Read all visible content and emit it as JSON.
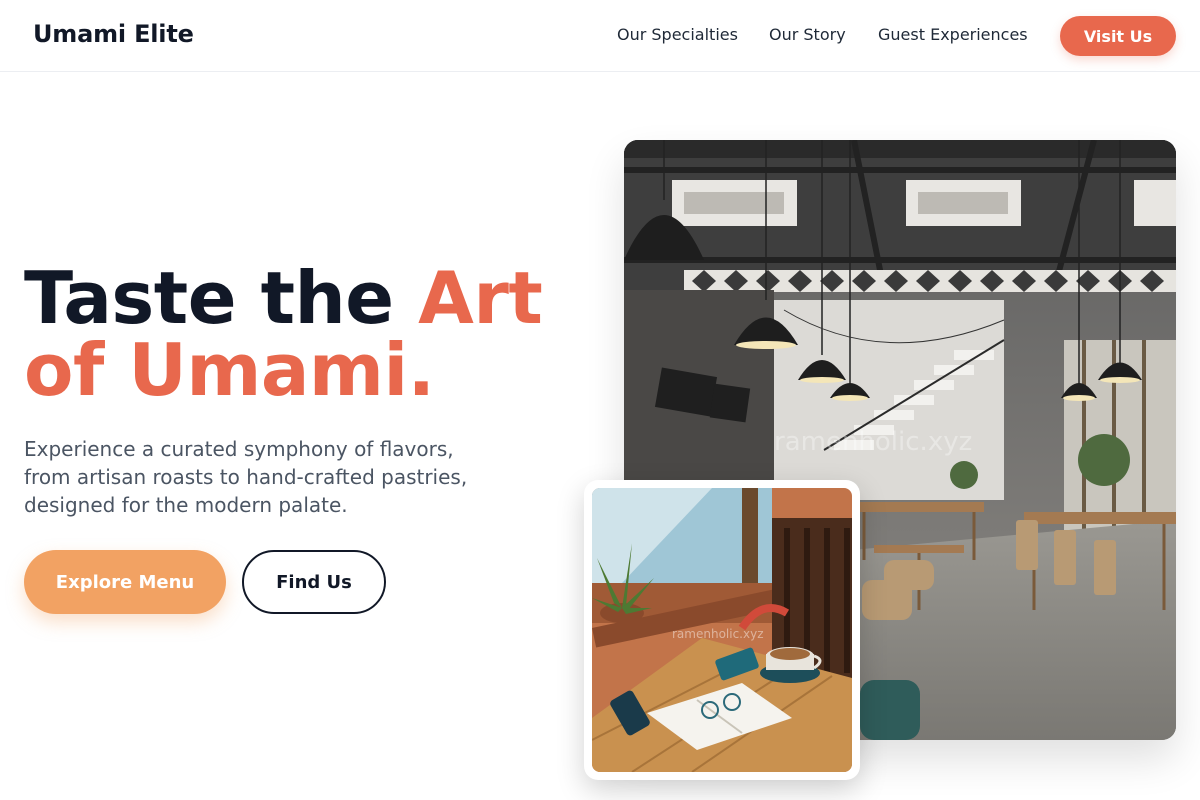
{
  "brand": {
    "name": "Umami Elite"
  },
  "nav": {
    "items": [
      "Our Specialties",
      "Our Story",
      "Guest Experiences"
    ],
    "cta_label": "Visit Us"
  },
  "hero": {
    "headline_part1": "Taste the ",
    "headline_accent1": "Art",
    "headline_accent2": "of Umami.",
    "subtitle": "Experience a curated symphony of flavors, from artisan roasts to hand-crafted pastries, designed for the modern palate.",
    "primary_button": "Explore Menu",
    "secondary_button": "Find Us"
  },
  "images": {
    "main_watermark": "ramenholic.xyz",
    "small_watermark": "ramenholic.xyz"
  },
  "colors": {
    "accent": "#e8684d",
    "primary_button": "#f2a263",
    "text_dark": "#111827",
    "text_muted": "#4b5563"
  }
}
